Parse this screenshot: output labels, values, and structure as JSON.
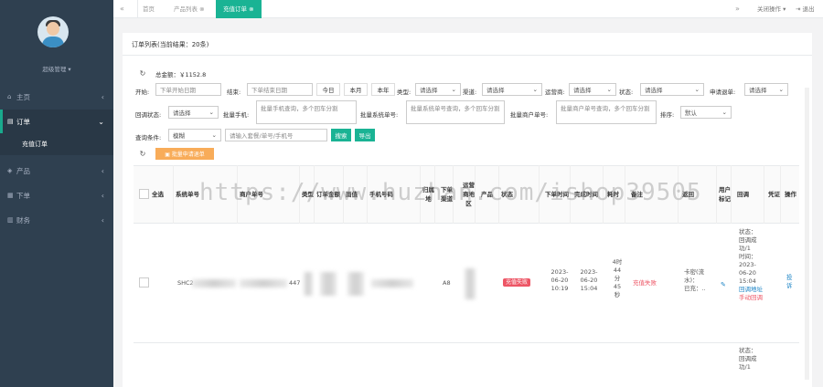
{
  "sidebar": {
    "username": "超级管理 ▾",
    "items": [
      {
        "label": "主页"
      },
      {
        "label": "订单",
        "sub": "充值订单"
      },
      {
        "label": "产品"
      },
      {
        "label": "下单"
      },
      {
        "label": "财务"
      }
    ]
  },
  "topbar": {
    "tabs": [
      "首页",
      "产品列表 ⊗",
      "充值订单 ⊗"
    ],
    "close_ops": "关闭操作 ▾",
    "logout": "⇥ 退出"
  },
  "panel": {
    "title": "订单列表(当前结果：20条)",
    "total": "总金额：￥1152.8",
    "filters": {
      "start_label": "开始:",
      "start_ph": "下单开始日期",
      "end_label": "结束:",
      "end_ph": "下单结束日期",
      "today": "今日",
      "this_month": "本月",
      "this_year": "本年",
      "type_label": "类型:",
      "type_val": "请选择",
      "channel_label": "渠道:",
      "channel_val": "请选择",
      "carrier_label": "运营商:",
      "carrier_val": "请选择",
      "status_label": "状态:",
      "status_val": "请选择",
      "refund_label": "申请退单:",
      "refund_val": "请选择",
      "callback_label": "回调状态:",
      "callback_val": "请选择",
      "phone_label": "批量手机:",
      "phone_ph": "批量手机查询，多个回车分割",
      "sysno_label": "批量系统单号:",
      "sysno_ph": "批量系统单号查询，多个回车分割",
      "mchno_label": "批量商户单号:",
      "mchno_ph": "批量商户单号查询，多个回车分割",
      "sort_label": "排序:",
      "sort_val": "默认",
      "query_label": "查询条件:",
      "query_val": "模糊",
      "query_ph": "请输入套餐/单号/手机号",
      "search": "搜索",
      "export": "导出",
      "batch_refund": "▣ 批量申请退单"
    }
  },
  "table": {
    "headers": [
      "全选",
      "系统单号",
      "商户单号",
      "类型",
      "订单金额",
      "面值",
      "手机号码",
      "归属地",
      "下单渠道",
      "运营商地区",
      "产品",
      "状态",
      "下单时间",
      "完成时间",
      "耗时",
      "备注",
      "返回",
      "用户标记",
      "回调",
      "凭证",
      "操作"
    ],
    "row": {
      "sys": "SHC2",
      "mch": "447",
      "area": "A8",
      "status": "充值失败",
      "order_time": [
        "2023-",
        "06-20",
        "10:19"
      ],
      "done_time": [
        "2023-",
        "06-20",
        "15:04"
      ],
      "cost": [
        "4时",
        "44",
        "分",
        "45",
        "秒"
      ],
      "remark": "充值失败",
      "ret": [
        "卡密(流",
        "水)：",
        "已充：.."
      ],
      "callback": [
        "状态：",
        "回调成",
        "功/1",
        "时间：",
        "2023-",
        "06-20",
        "15:04"
      ],
      "callback_link": "回调地址",
      "manual": "手动回调",
      "action": "投诉"
    },
    "row2_callback": [
      "状态：",
      "回调成",
      "功/1"
    ]
  },
  "watermark": "https://www.huzhan.com/ishop39505"
}
